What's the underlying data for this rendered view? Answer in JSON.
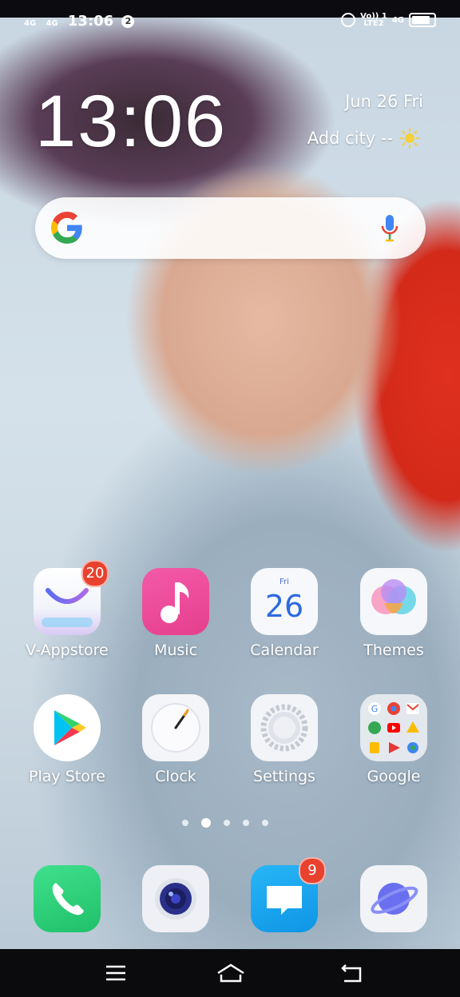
{
  "status": {
    "net1": "4G",
    "net2": "4G",
    "time": "13:06",
    "notif_count": "2",
    "volte": "Vo)) 1",
    "lte": "LTE2",
    "net3": "4G",
    "battery_level": 0.85
  },
  "widget": {
    "time": "13:06",
    "date": "Jun 26 Fri",
    "city": "Add city --"
  },
  "search": {
    "google_letter": "G"
  },
  "apps_row1": [
    {
      "label": "V-Appstore",
      "badge": "20"
    },
    {
      "label": "Music"
    },
    {
      "label": "Calendar",
      "day_name": "Fri",
      "day_num": "26"
    },
    {
      "label": "Themes"
    }
  ],
  "apps_row2": [
    {
      "label": "Play Store"
    },
    {
      "label": "Clock"
    },
    {
      "label": "Settings"
    },
    {
      "label": "Google"
    }
  ],
  "dock": [
    {
      "name": "Phone"
    },
    {
      "name": "Camera"
    },
    {
      "name": "Messages",
      "badge": "9"
    },
    {
      "name": "Browser"
    }
  ],
  "page_indicator": {
    "count": 5,
    "active": 2
  },
  "colors": {
    "badge_red": "#e8412e",
    "music_pink": "#e8489a",
    "phone_green": "#2fcf7a",
    "messages_blue": "#1aa6ef"
  }
}
